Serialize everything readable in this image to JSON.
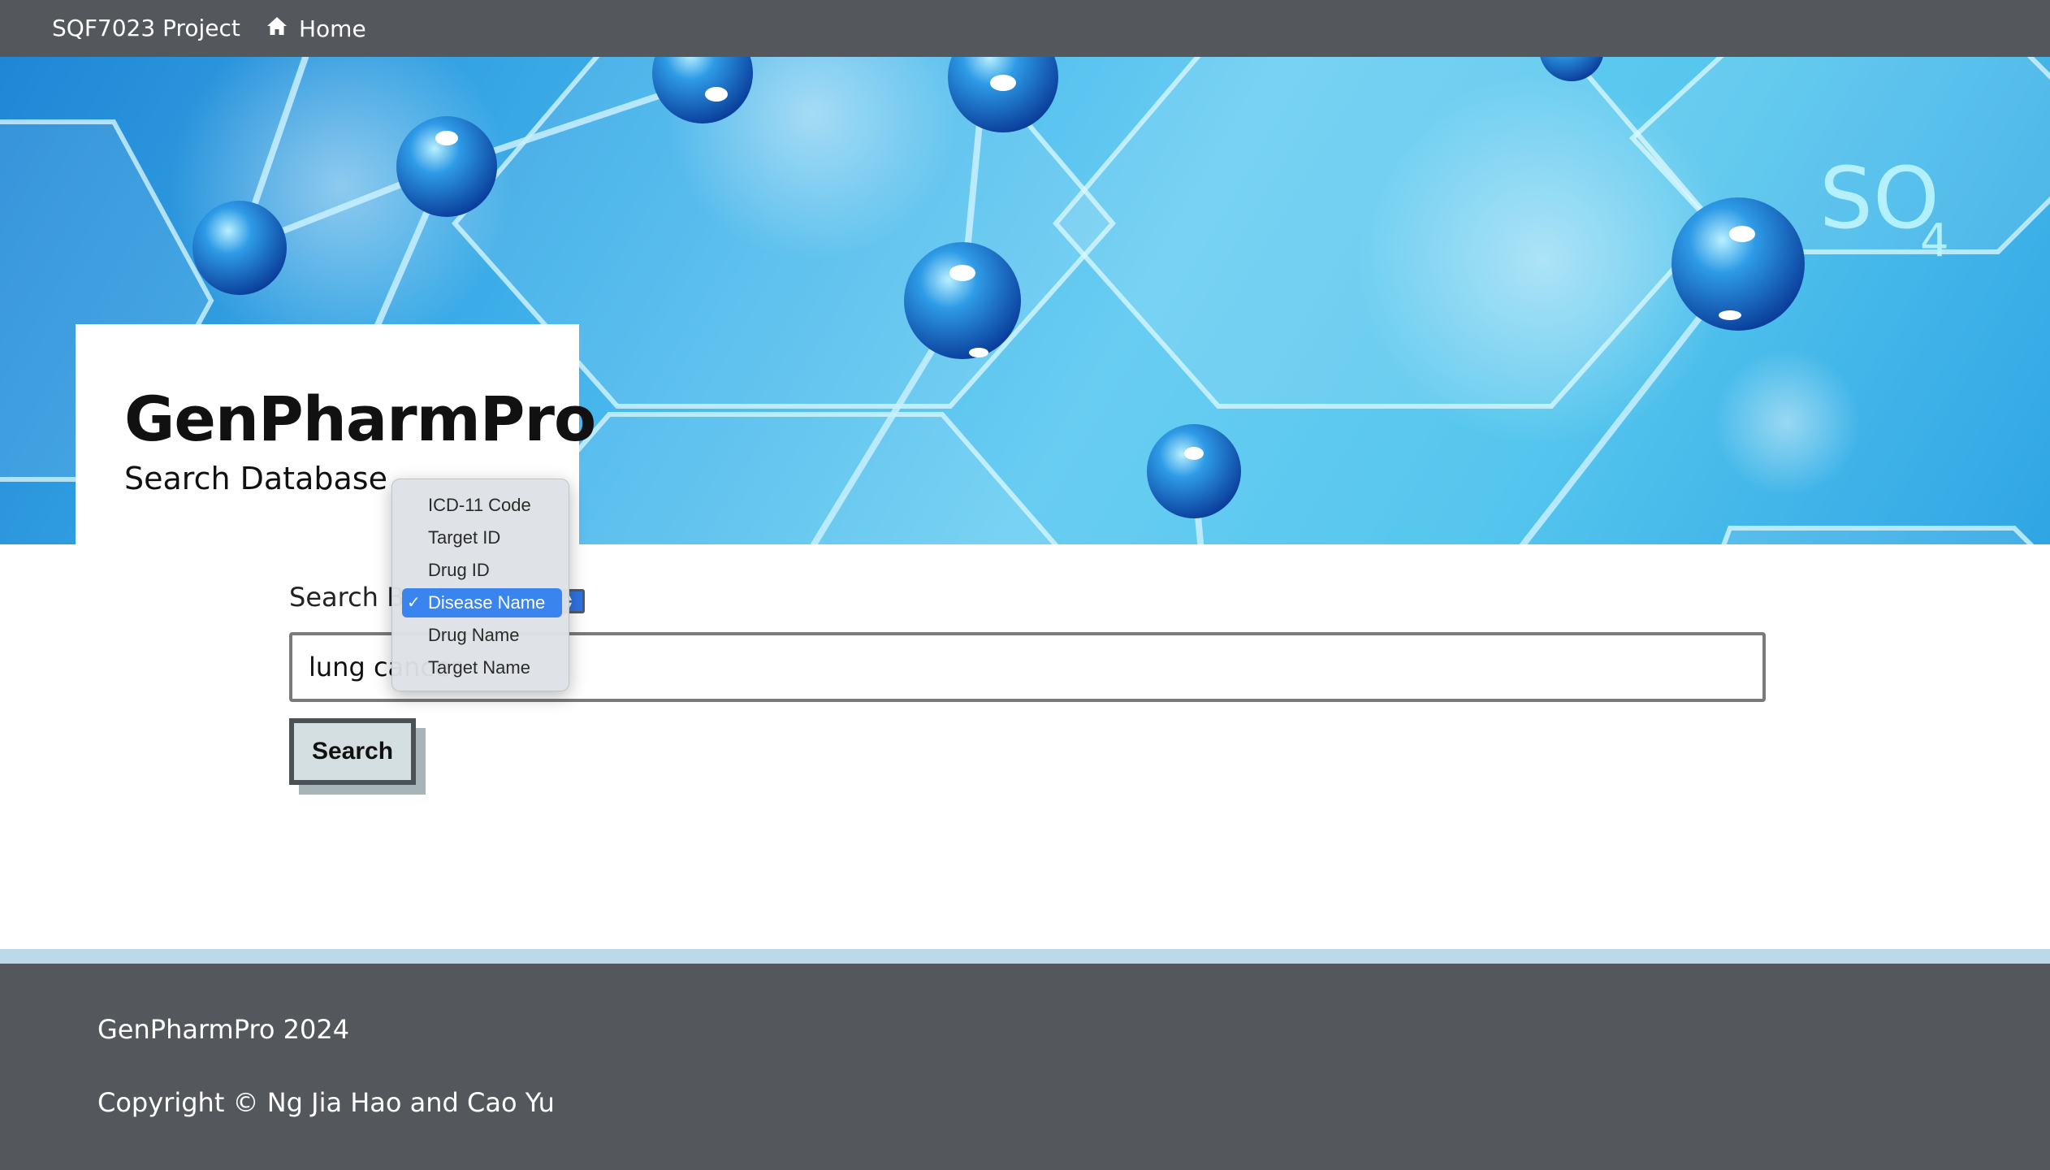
{
  "nav": {
    "brand": "SQF7023 Project",
    "home_label": "Home"
  },
  "hero": {
    "title": "GenPharmPro",
    "subtitle": "Search Database",
    "image_text": "SO",
    "image_subscript": "4"
  },
  "search": {
    "by_label": "Search By",
    "options": [
      "ICD-11 Code",
      "Target ID",
      "Drug ID",
      "Disease Name",
      "Drug Name",
      "Target Name"
    ],
    "selected_option": "Disease Name",
    "check_mark": "✓",
    "input_value": "lung cancer",
    "button_label": "Search"
  },
  "footer": {
    "line1": "GenPharmPro 2024",
    "line2": "Copyright © Ng Jia Hao and Cao Yu"
  },
  "colors": {
    "nav_bg": "#54585c",
    "footer_bg": "#54585c",
    "footer_stripe": "#bcd9ea",
    "selected_option_bg": "#3a84f0",
    "button_bg": "#d3dfe0"
  }
}
